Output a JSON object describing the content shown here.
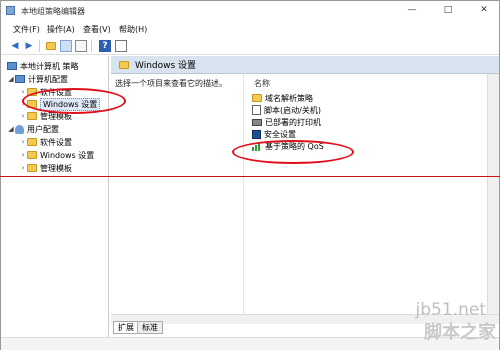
{
  "window": {
    "title": "本地组策略编辑器",
    "min_btn": "—",
    "max_btn": "□",
    "close_btn": "✕"
  },
  "menu": {
    "file": "文件(F)",
    "action": "操作(A)",
    "view": "查看(V)",
    "help": "帮助(H)"
  },
  "toolbar": {
    "back_icon": "arrow-left-icon",
    "forward_icon": "arrow-right-icon",
    "up_icon": "folder-up-icon",
    "show_tree_icon": "tree-view-icon",
    "export_icon": "export-list-icon",
    "help_icon": "help-icon",
    "properties_icon": "properties-icon"
  },
  "tree": {
    "root": "本地计算机 策略",
    "computer_config": "计算机配置",
    "computer_children": [
      "软件设置",
      "Windows 设置",
      "管理模板"
    ],
    "user_config": "用户配置",
    "user_children": [
      "软件设置",
      "Windows 设置",
      "管理模板"
    ]
  },
  "right": {
    "header_title": "Windows 设置",
    "description": "选择一个项目来查看它的描述。",
    "column_name": "名称",
    "items": [
      "域名解析策略",
      "脚本(启动/关机)",
      "已部署的打印机",
      "安全设置",
      "基于策略的 QoS"
    ]
  },
  "tabs": {
    "extended": "扩展",
    "standard": "标准"
  },
  "watermark": {
    "url": "jb51.net",
    "brand": "脚本之家"
  },
  "colors": {
    "annotation_red": "#e0101a",
    "header_bar": "#d9e3ef",
    "folder_yellow": "#f3c94f"
  }
}
